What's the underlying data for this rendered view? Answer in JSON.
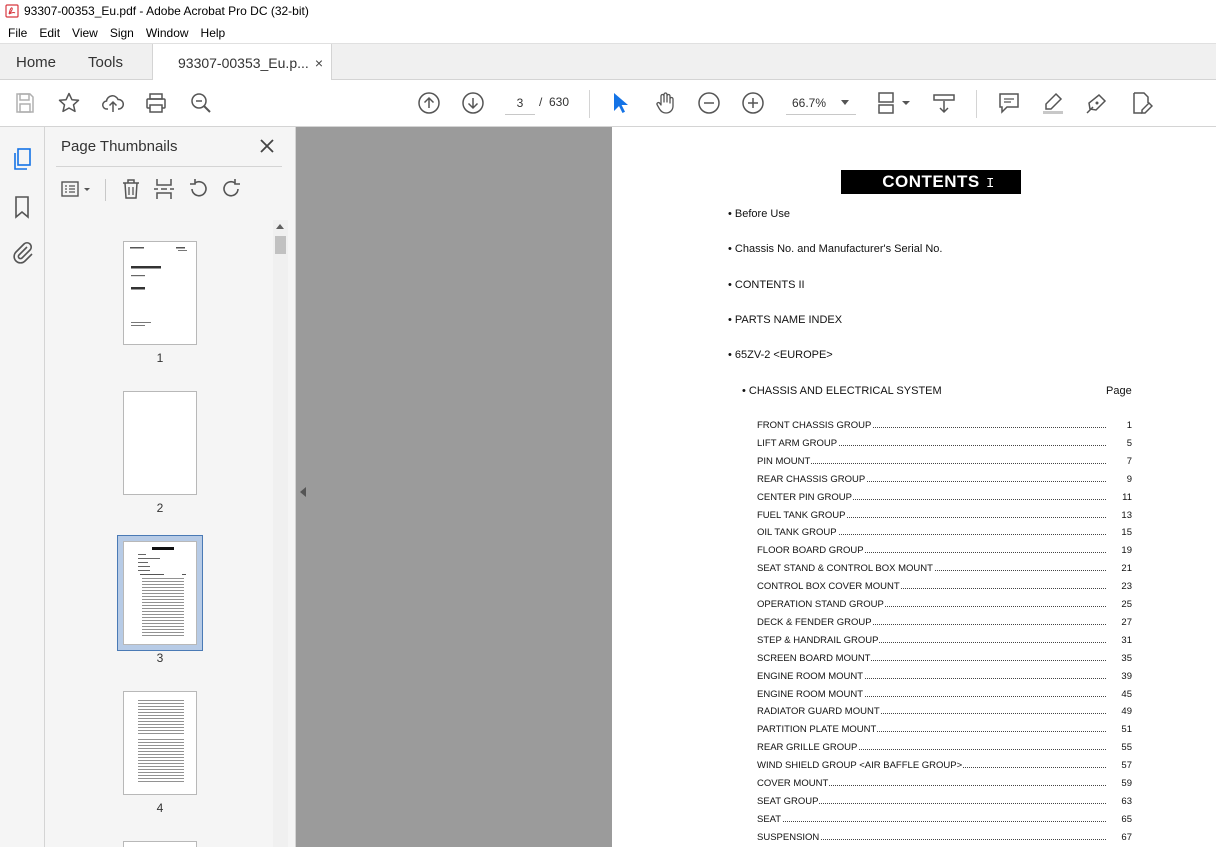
{
  "window": {
    "title": "93307-00353_Eu.pdf - Adobe Acrobat Pro DC (32-bit)"
  },
  "menu": [
    "File",
    "Edit",
    "View",
    "Sign",
    "Window",
    "Help"
  ],
  "tabs": {
    "home": "Home",
    "tools": "Tools",
    "document": "93307-00353_Eu.p...",
    "close_glyph": "×"
  },
  "toolbar": {
    "current_page": "3",
    "page_separator": "/",
    "total_pages": "630",
    "zoom": "66.7%"
  },
  "thumbnails": {
    "panel_title": "Page Thumbnails",
    "pages": [
      {
        "label": "1"
      },
      {
        "label": "2"
      },
      {
        "label": "3",
        "selected": true
      },
      {
        "label": "4"
      }
    ]
  },
  "document": {
    "heading": "CONTENTS",
    "cursor": "I",
    "bullets": [
      "• Before Use",
      "• Chassis No. and Manufacturer's Serial No.",
      "• CONTENTS II",
      "• PARTS NAME INDEX",
      "• 65ZV-2 <EUROPE>"
    ],
    "section": {
      "title": "• CHASSIS AND ELECTRICAL SYSTEM",
      "page_header": "Page"
    },
    "toc": [
      {
        "name": "FRONT CHASSIS GROUP",
        "page": "1"
      },
      {
        "name": "LIFT ARM GROUP",
        "page": "5"
      },
      {
        "name": "PIN MOUNT",
        "page": "7"
      },
      {
        "name": "REAR CHASSIS GROUP",
        "page": "9"
      },
      {
        "name": "CENTER PIN GROUP",
        "page": "11"
      },
      {
        "name": "FUEL TANK GROUP",
        "page": "13"
      },
      {
        "name": "OIL TANK GROUP",
        "page": "15"
      },
      {
        "name": "FLOOR BOARD GROUP",
        "page": "19"
      },
      {
        "name": "SEAT STAND & CONTROL BOX MOUNT",
        "page": "21"
      },
      {
        "name": "CONTROL BOX COVER MOUNT",
        "page": "23"
      },
      {
        "name": "OPERATION STAND GROUP",
        "page": "25"
      },
      {
        "name": "DECK & FENDER GROUP",
        "page": "27"
      },
      {
        "name": "STEP & HANDRAIL GROUP",
        "page": "31"
      },
      {
        "name": "SCREEN BOARD MOUNT",
        "page": "35"
      },
      {
        "name": "ENGINE ROOM MOUNT",
        "page": "39"
      },
      {
        "name": "ENGINE ROOM MOUNT",
        "page": "45"
      },
      {
        "name": "RADIATOR GUARD MOUNT",
        "page": "49"
      },
      {
        "name": "PARTITION PLATE MOUNT",
        "page": "51"
      },
      {
        "name": "REAR GRILLE GROUP",
        "page": "55"
      },
      {
        "name": "WIND SHIELD GROUP <AIR BAFFLE GROUP>",
        "page": "57"
      },
      {
        "name": "COVER MOUNT",
        "page": "59"
      },
      {
        "name": "SEAT GROUP",
        "page": "63"
      },
      {
        "name": "SEAT",
        "page": "65"
      },
      {
        "name": "SUSPENSION",
        "page": "67"
      }
    ]
  },
  "colors": {
    "accent": "#1473e6",
    "pdf_red": "#d7373f",
    "doc_bg": "#9b9b9b"
  }
}
